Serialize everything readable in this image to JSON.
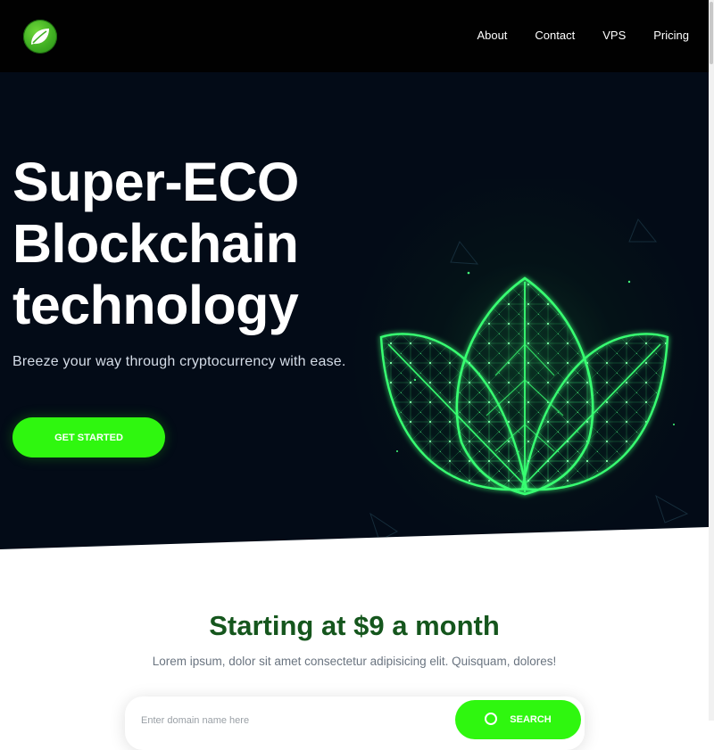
{
  "nav": {
    "logo_icon": "leaf-logo-icon",
    "links": [
      "About",
      "Contact",
      "VPS",
      "Pricing"
    ]
  },
  "hero": {
    "title": "Super-ECO Blockchain technology",
    "subtitle": "Breeze your way through cryptocurrency with ease.",
    "cta_label": "GET STARTED",
    "illustration_icon": "lotus-network-illustration"
  },
  "pricing": {
    "title": "Starting at $9 a month",
    "subtitle": "Lorem ipsum, dolor sit amet consectetur adipisicing elit. Quisquam, dolores!"
  },
  "domain_search": {
    "placeholder": "Enter domain name here",
    "button_label": "SEARCH",
    "button_icon": "search-icon"
  },
  "colors": {
    "accent_green": "#2ff70f",
    "heading_green": "#15561d",
    "hero_background": "#030b17",
    "navbar_background": "#010101"
  }
}
